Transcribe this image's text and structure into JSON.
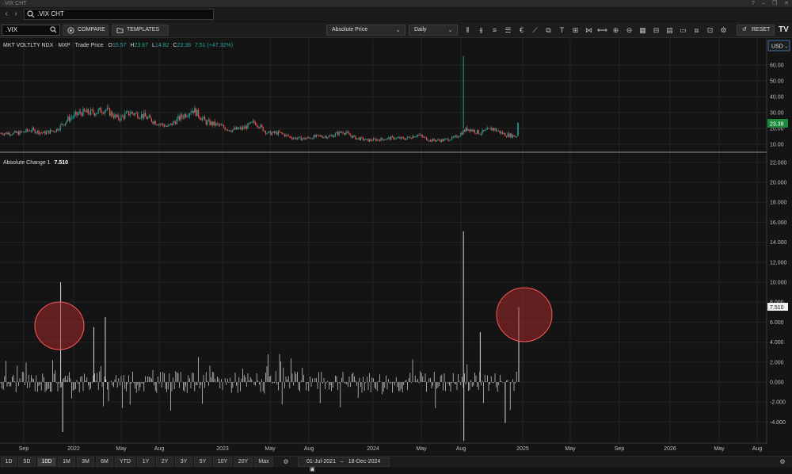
{
  "window": {
    "title": ".VIX CHT",
    "help_icon": "help-icon",
    "min_icon": "minimize-icon"
  },
  "nav": {
    "back_icon": "chevron-left-icon",
    "forward_icon": "chevron-right-icon",
    "omnibox_value": ".VIX CHT"
  },
  "toolbar": {
    "symbol_value": ".VIX",
    "compare_label": "COMPARE",
    "templates_label": "TEMPLATES",
    "price_type": "Absolute Price",
    "interval": "Daily",
    "reset_label": "RESET",
    "currency": "USD"
  },
  "legend": {
    "name": "MKT VOLTLTY NDX",
    "exchange": "MXP",
    "price_label": "Trade Price",
    "o_label": "O",
    "o_value": "15.57",
    "h_label": "H",
    "h_value": "23.87",
    "l_label": "L",
    "l_value": "14.82",
    "c_label": "C",
    "c_value": "23.38",
    "change": "7.51 (+47.32%)",
    "last_price_tag": "23.38"
  },
  "indicator": {
    "name": "Absolute Change 1",
    "value": "7.510",
    "last_value_tag": "7.510"
  },
  "price_axis": [
    "60.00",
    "50.00",
    "40.00",
    "30.00",
    "20.00",
    "10.00"
  ],
  "indicator_axis": [
    "22.000",
    "20.000",
    "18.000",
    "16.000",
    "14.000",
    "12.000",
    "10.000",
    "8.000",
    "6.000",
    "4.000",
    "2.000",
    "0.000",
    "-2.000",
    "-4.000"
  ],
  "time_axis": [
    "Sep",
    "2022",
    "May",
    "Aug",
    "2023",
    "May",
    "Aug",
    "2024",
    "May",
    "Aug",
    "2025",
    "May",
    "Sep",
    "2026",
    "May",
    "Aug"
  ],
  "bottom": {
    "ranges": [
      "1D",
      "5D",
      "10D",
      "1M",
      "3M",
      "6M",
      "YTD",
      "1Y",
      "2Y",
      "3Y",
      "5Y",
      "10Y",
      "20Y",
      "Max"
    ],
    "selected_range": "10D",
    "date_from": "01-Jul-2021",
    "date_to": "18-Dec-2024"
  },
  "colors": {
    "up": "#26a69a",
    "down": "#ef5350",
    "panel_bg": "#141414",
    "tag_green": "#1b8a3a",
    "highlight_circle": "#b02a2a",
    "bars": "#d9d9d9"
  },
  "chart_data": [
    {
      "type": "candlestick",
      "title": "MKT VOLTLTY NDX",
      "x_range": [
        "2021-07-01",
        "2024-12-18"
      ],
      "ylim": [
        5,
        68
      ],
      "grid": true,
      "series": [
        {
          "values": [
            {
              "x": "2021-08",
              "y": 17
            },
            {
              "x": "2021-09",
              "y": 19
            },
            {
              "x": "2021-10",
              "y": 17
            },
            {
              "x": "2021-11",
              "y": 19
            },
            {
              "x": "2021-12",
              "y": 26
            },
            {
              "x": "2022-01",
              "y": 30
            },
            {
              "x": "2022-02",
              "y": 30
            },
            {
              "x": "2022-03",
              "y": 32
            },
            {
              "x": "2022-04",
              "y": 26
            },
            {
              "x": "2022-05",
              "y": 30
            },
            {
              "x": "2022-06",
              "y": 28
            },
            {
              "x": "2022-07",
              "y": 24
            },
            {
              "x": "2022-08",
              "y": 21
            },
            {
              "x": "2022-09",
              "y": 27
            },
            {
              "x": "2022-10",
              "y": 32
            },
            {
              "x": "2022-11",
              "y": 24
            },
            {
              "x": "2022-12",
              "y": 22
            },
            {
              "x": "2023-01",
              "y": 19
            },
            {
              "x": "2023-02",
              "y": 20
            },
            {
              "x": "2023-03",
              "y": 24
            },
            {
              "x": "2023-04",
              "y": 17
            },
            {
              "x": "2023-05",
              "y": 17
            },
            {
              "x": "2023-06",
              "y": 14
            },
            {
              "x": "2023-07",
              "y": 13.5
            },
            {
              "x": "2023-08",
              "y": 15
            },
            {
              "x": "2023-09",
              "y": 15
            },
            {
              "x": "2023-10",
              "y": 18
            },
            {
              "x": "2023-11",
              "y": 14
            },
            {
              "x": "2023-12",
              "y": 12.5
            },
            {
              "x": "2024-01",
              "y": 13
            },
            {
              "x": "2024-02",
              "y": 14
            },
            {
              "x": "2024-03",
              "y": 13.5
            },
            {
              "x": "2024-04",
              "y": 16
            },
            {
              "x": "2024-05",
              "y": 12.5
            },
            {
              "x": "2024-06",
              "y": 12.5
            },
            {
              "x": "2024-07",
              "y": 14
            },
            {
              "x": "2024-08",
              "y": 20
            },
            {
              "x": "2024-09",
              "y": 17
            },
            {
              "x": "2024-10",
              "y": 20
            },
            {
              "x": "2024-11",
              "y": 16
            },
            {
              "x": "2024-12",
              "y": 15
            }
          ]
        }
      ],
      "spike": {
        "x": "2024-08-05",
        "y": 65.73
      },
      "last": {
        "o": 15.57,
        "h": 23.87,
        "l": 14.82,
        "c": 23.38
      }
    },
    {
      "type": "bar",
      "title": "Absolute Change 1",
      "ylim": [
        -5,
        22
      ],
      "grid": true,
      "highlights": [
        {
          "x": "2021-12",
          "y": 10.0
        },
        {
          "x": "2024-12-18",
          "y": 7.51
        }
      ],
      "extremes": [
        {
          "x": "2021-11-26",
          "y": 10.0
        },
        {
          "x": "2021-12-01",
          "y": -5.0
        },
        {
          "x": "2022-02",
          "y": 5.5
        },
        {
          "x": "2022-03",
          "y": 6.5
        },
        {
          "x": "2024-08-05",
          "y": 15.1
        },
        {
          "x": "2024-08-06",
          "y": -5.9
        },
        {
          "x": "2024-09",
          "y": 5.0
        },
        {
          "x": "2024-11",
          "y": -4.1
        },
        {
          "x": "2024-12-18",
          "y": 7.51
        }
      ]
    }
  ]
}
